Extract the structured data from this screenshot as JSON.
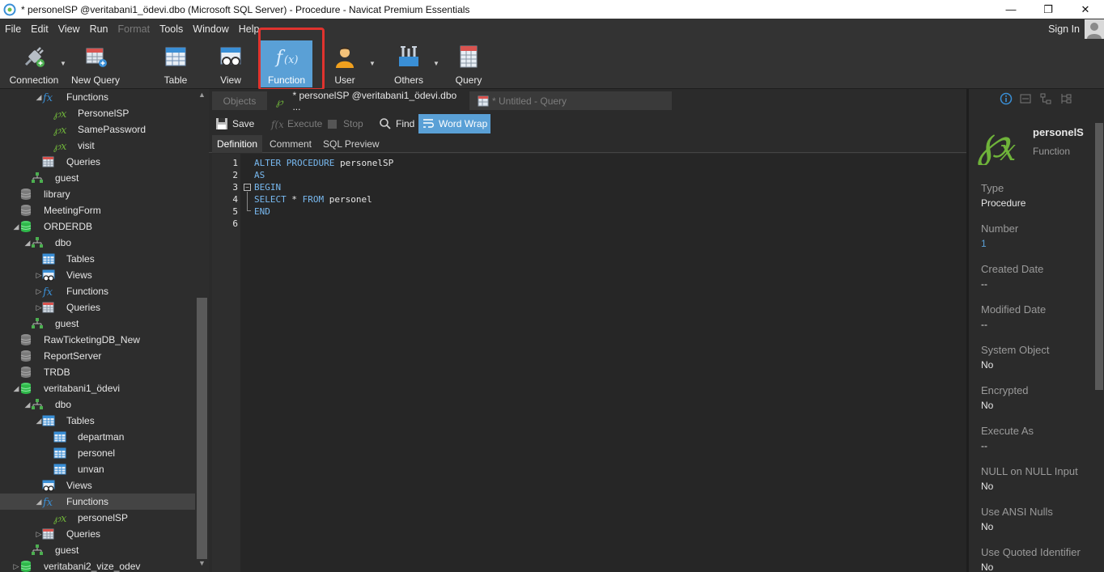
{
  "window": {
    "title": "* personelSP @veritabani1_ödevi.dbo (Microsoft SQL Server) - Procedure - Navicat Premium Essentials",
    "minimize": "—",
    "restore": "❐",
    "close": "✕"
  },
  "menu": {
    "items": [
      "File",
      "Edit",
      "View",
      "Run",
      "Format",
      "Tools",
      "Window",
      "Help"
    ],
    "sign_in": "Sign In"
  },
  "toolbar": {
    "connection": "Connection",
    "new_query": "New Query",
    "table": "Table",
    "view": "View",
    "function": "Function",
    "user": "User",
    "others": "Others",
    "query": "Query"
  },
  "tree": [
    {
      "label": "Functions"
    },
    {
      "label": "PersonelSP"
    },
    {
      "label": "SamePassword"
    },
    {
      "label": "visit"
    },
    {
      "label": "Queries"
    },
    {
      "label": "guest"
    },
    {
      "label": "library"
    },
    {
      "label": "MeetingForm"
    },
    {
      "label": "ORDERDB"
    },
    {
      "label": "dbo"
    },
    {
      "label": "Tables"
    },
    {
      "label": "Views"
    },
    {
      "label": "Functions"
    },
    {
      "label": "Queries"
    },
    {
      "label": "guest"
    },
    {
      "label": "RawTicketingDB_New"
    },
    {
      "label": "ReportServer"
    },
    {
      "label": "TRDB"
    },
    {
      "label": "veritabani1_ödevi"
    },
    {
      "label": "dbo"
    },
    {
      "label": "Tables"
    },
    {
      "label": "departman"
    },
    {
      "label": "personel"
    },
    {
      "label": "unvan"
    },
    {
      "label": "Views"
    },
    {
      "label": "Functions"
    },
    {
      "label": "personelSP"
    },
    {
      "label": "Queries"
    },
    {
      "label": "guest"
    },
    {
      "label": "veritabani2_vize_odev"
    }
  ],
  "tabs": {
    "objects": "Objects",
    "procedure": "* personelSP @veritabani1_ödevi.dbo ...",
    "query": "* Untitled - Query"
  },
  "editor_toolbar": {
    "save": "Save",
    "execute": "Execute",
    "stop": "Stop",
    "find": "Find",
    "word_wrap": "Word Wrap"
  },
  "subtabs": {
    "definition": "Definition",
    "comment": "Comment",
    "sql_preview": "SQL Preview"
  },
  "code": {
    "line_numbers": [
      "1",
      "2",
      "3",
      "4",
      "5",
      "6"
    ],
    "l1_kw": "ALTER PROCEDURE",
    "l1_rest": " personelSP",
    "l2_kw": "AS",
    "l3_kw": "BEGIN",
    "l4_kw1": "SELECT",
    "l4_mid": " * ",
    "l4_kw2": "FROM",
    "l4_rest": " personel",
    "l5_kw": "END",
    "fold_sign": "−"
  },
  "properties": {
    "name": "personelS",
    "kind": "Function",
    "type_label": "Type",
    "type_value": "Procedure",
    "number_label": "Number",
    "number_value": "1",
    "created_label": "Created Date",
    "created_value": "--",
    "modified_label": "Modified Date",
    "modified_value": "--",
    "system_label": "System Object",
    "system_value": "No",
    "encrypted_label": "Encrypted",
    "encrypted_value": "No",
    "execute_label": "Execute As",
    "execute_value": "--",
    "nullnull_label": "NULL on NULL Input",
    "nullnull_value": "No",
    "ansi_label": "Use ANSI Nulls",
    "ansi_value": "No",
    "quoted_label": "Use Quoted Identifier",
    "quoted_value": "No"
  },
  "colors": {
    "accent": "#5aa0d6",
    "keyword": "#78b9f0",
    "db_green": "#2fb84a",
    "function_green": "#6fb33a",
    "highlight_red": "#e0332e"
  }
}
